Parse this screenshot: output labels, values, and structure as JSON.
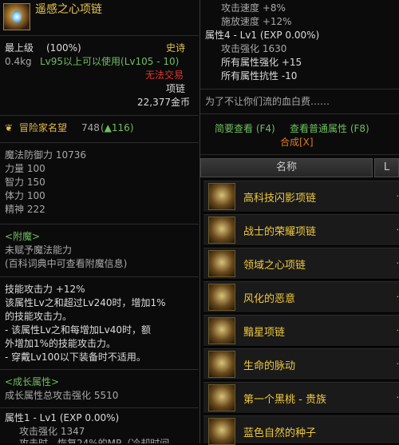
{
  "tooltip": {
    "item_name": "遥感之心项链",
    "level_label": "最上级",
    "level_pct": "(100%)",
    "rarity": "史诗",
    "weight": "0.4kg",
    "level_req": "Lv95以上可以使用(Lv105 - 10)",
    "trade": "无法交易",
    "slot": "项链",
    "price": "22,377金币",
    "fame_label": "冒险家名望",
    "fame_value": "748",
    "fame_delta": "(▲116)",
    "stats": [
      "魔法防御力 10736",
      "力量 100",
      "智力 150",
      "体力 100",
      "精神 222"
    ],
    "enchant_title": "<附魔>",
    "enchant_lines": [
      "未赋予魔法能力",
      "(百科词典中可查看附魔信息)"
    ],
    "skill_lines": [
      "技能攻击力 +12%",
      "该属性Lv之和超过Lv240时，增加1%",
      "的技能攻击力。",
      "- 该属性Lv之和每增加Lv40时，额",
      "外增加1%的技能攻击力。",
      "- 穿戴Lv100以下装备时不适用。"
    ],
    "growth_title": "<成长属性>",
    "growth_total": "成长属性总攻击强化 5510",
    "attr1": "属性1 - Lv1 (EXP 0.00%)",
    "attr1_sub": "攻击强化 1347",
    "attr1_cut": "攻击时，恢复24%的MP（冷却时间"
  },
  "tooltip2": {
    "lines_top": [
      "攻击速度 +8%",
      "施放速度 +12%"
    ],
    "attr4": "属性4 - Lv1 (EXP 0.00%)",
    "attr4_lines": [
      "攻击强化 1630",
      "所有属性强化 +15",
      "所有属性抗性 -10"
    ],
    "flavor": "为了不让你们流的血白费……",
    "brief_view": "简要查看 (F4)",
    "normal_view": "查看普通属性 (F8)",
    "synth": "合成[X]"
  },
  "list": {
    "col_name": "名称",
    "col_level": "L",
    "items": [
      "高科技闪影项链",
      "战士的荣耀项链",
      "领域之心项链",
      "风化的恶意",
      "黯星项链",
      "生命的脉动",
      "第一个黑桃 - 贵族",
      "蓝色自然的种子"
    ]
  }
}
